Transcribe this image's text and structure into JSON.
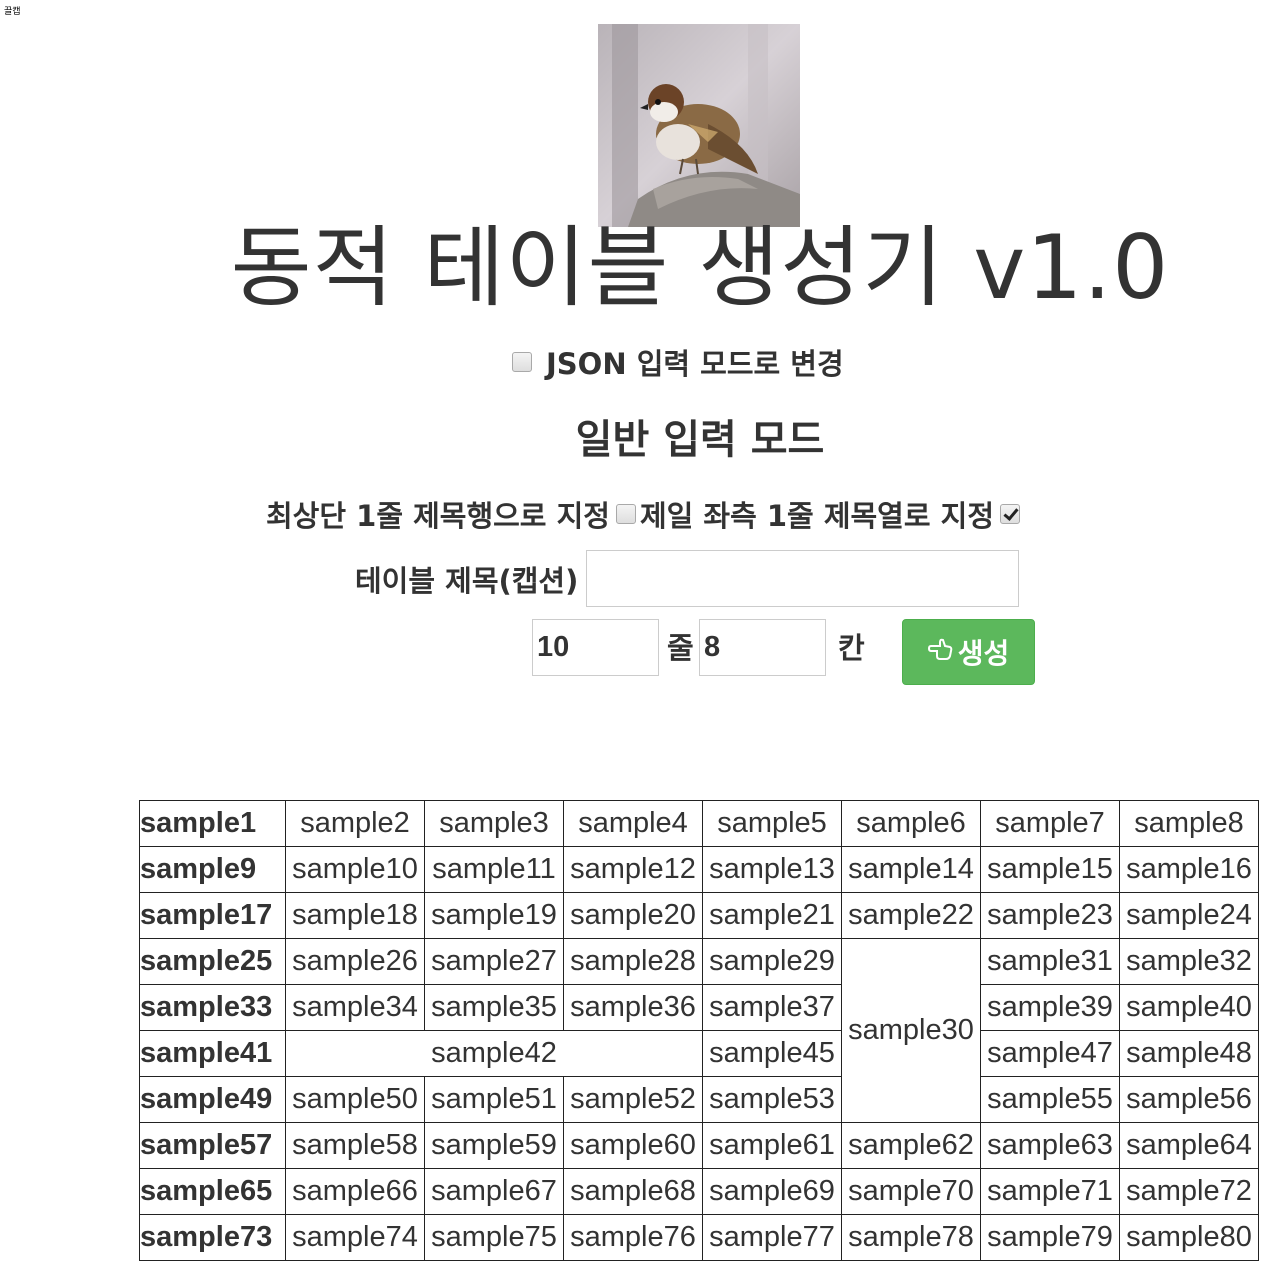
{
  "corner_label": "끌캡",
  "logo_alt": "sparrow-logo",
  "title": "동적 테이블 생성기 v1.0",
  "json_mode": {
    "label": "JSON 입력 모드로 변경",
    "checked": false
  },
  "mode_heading": "일반 입력 모드",
  "options": {
    "header_row_label": "최상단 1줄 제목행으로 지정",
    "header_row_checked": false,
    "header_col_label": "제일 좌측 1줄 제목열로 지정",
    "header_col_checked": true
  },
  "caption": {
    "label": "테이블 제목(캡션)",
    "value": "",
    "placeholder": ""
  },
  "size": {
    "rows_value": "10",
    "rows_unit": "줄",
    "cols_value": "8",
    "cols_unit": "칸"
  },
  "generate_button": {
    "label": "생성",
    "icon": "hand-point-left-icon"
  },
  "colors": {
    "button_green": "#5cb85c",
    "text": "#333333"
  },
  "table": {
    "rows": [
      [
        {
          "t": "sample1",
          "h": true
        },
        {
          "t": "sample2"
        },
        {
          "t": "sample3"
        },
        {
          "t": "sample4"
        },
        {
          "t": "sample5"
        },
        {
          "t": "sample6"
        },
        {
          "t": "sample7"
        },
        {
          "t": "sample8"
        }
      ],
      [
        {
          "t": "sample9",
          "h": true
        },
        {
          "t": "sample10"
        },
        {
          "t": "sample11"
        },
        {
          "t": "sample12"
        },
        {
          "t": "sample13"
        },
        {
          "t": "sample14"
        },
        {
          "t": "sample15"
        },
        {
          "t": "sample16"
        }
      ],
      [
        {
          "t": "sample17",
          "h": true
        },
        {
          "t": "sample18"
        },
        {
          "t": "sample19"
        },
        {
          "t": "sample20"
        },
        {
          "t": "sample21"
        },
        {
          "t": "sample22"
        },
        {
          "t": "sample23"
        },
        {
          "t": "sample24"
        }
      ],
      [
        {
          "t": "sample25",
          "h": true
        },
        {
          "t": "sample26"
        },
        {
          "t": "sample27"
        },
        {
          "t": "sample28"
        },
        {
          "t": "sample29"
        },
        {
          "t": "sample30",
          "rowspan": 4
        },
        {
          "t": "sample31"
        },
        {
          "t": "sample32"
        }
      ],
      [
        {
          "t": "sample33",
          "h": true
        },
        {
          "t": "sample34"
        },
        {
          "t": "sample35"
        },
        {
          "t": "sample36"
        },
        {
          "t": "sample37"
        },
        {
          "t": "sample39"
        },
        {
          "t": "sample40"
        }
      ],
      [
        {
          "t": "sample41",
          "h": true
        },
        {
          "t": "sample42",
          "colspan": 3
        },
        {
          "t": "sample45"
        },
        {
          "t": "sample47"
        },
        {
          "t": "sample48"
        }
      ],
      [
        {
          "t": "sample49",
          "h": true
        },
        {
          "t": "sample50"
        },
        {
          "t": "sample51"
        },
        {
          "t": "sample52"
        },
        {
          "t": "sample53"
        },
        {
          "t": "sample55"
        },
        {
          "t": "sample56"
        }
      ],
      [
        {
          "t": "sample57",
          "h": true
        },
        {
          "t": "sample58"
        },
        {
          "t": "sample59"
        },
        {
          "t": "sample60"
        },
        {
          "t": "sample61"
        },
        {
          "t": "sample62"
        },
        {
          "t": "sample63"
        },
        {
          "t": "sample64"
        }
      ],
      [
        {
          "t": "sample65",
          "h": true
        },
        {
          "t": "sample66"
        },
        {
          "t": "sample67"
        },
        {
          "t": "sample68"
        },
        {
          "t": "sample69"
        },
        {
          "t": "sample70"
        },
        {
          "t": "sample71"
        },
        {
          "t": "sample72"
        }
      ],
      [
        {
          "t": "sample73",
          "h": true
        },
        {
          "t": "sample74"
        },
        {
          "t": "sample75"
        },
        {
          "t": "sample76"
        },
        {
          "t": "sample77"
        },
        {
          "t": "sample78"
        },
        {
          "t": "sample79"
        },
        {
          "t": "sample80"
        }
      ]
    ]
  }
}
